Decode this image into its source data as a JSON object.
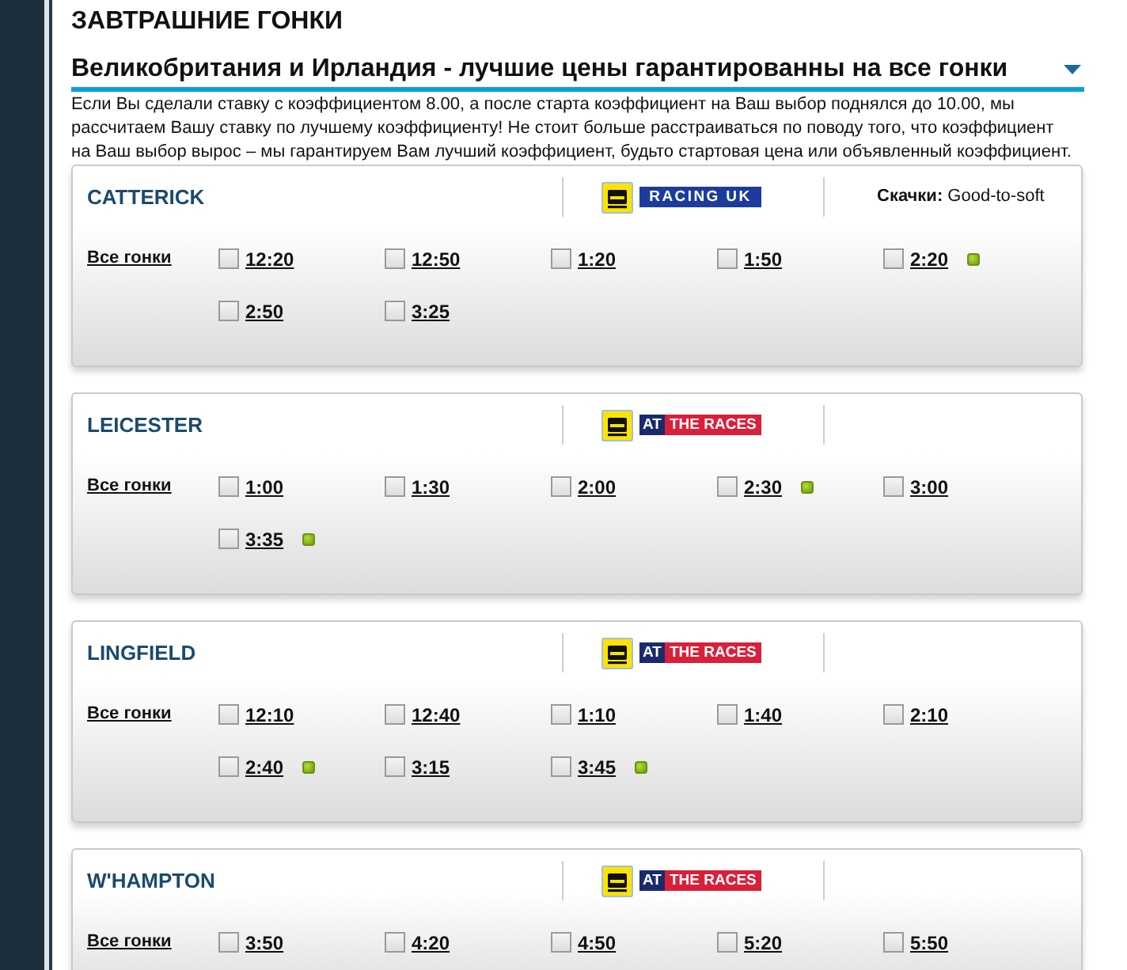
{
  "page": {
    "title": "ЗАВТРАШНИЕ ГОНКИ"
  },
  "region": {
    "title": "Великобритания и Ирландия - лучшие цены гарантированны на все гонки"
  },
  "intro": "Если Вы сделали ставку с коэффициентом 8.00, а после старта коэффициент на Ваш выбор поднялся до 10.00, мы рассчитаем Вашу ставку по лучшему коэффициенту! Не стоит больше расстраиваться по поводу того, что коэффициент на Ваш выбор вырос – мы гарантируем Вам лучший коэффициент, будьто стартовая цена или объявленный коэффициент.",
  "meetings": [
    {
      "name": "CATTERICK",
      "broadcaster": {
        "kind": "racing_uk",
        "words": [
          "RACING UK"
        ]
      },
      "going": "**Скачки:** Good-to-soft",
      "all_races_link": "Все гонки",
      "races": [
        {
          "time": "12:20",
          "checked": false,
          "status_dot": false
        },
        {
          "time": "12:50",
          "checked": false,
          "status_dot": false
        },
        {
          "time": "1:20",
          "checked": false,
          "status_dot": false
        },
        {
          "time": "1:50",
          "checked": false,
          "status_dot": false
        },
        {
          "time": "2:20",
          "checked": false,
          "status_dot": true
        },
        {
          "time": "2:50",
          "checked": false,
          "status_dot": false
        },
        {
          "time": "3:25",
          "checked": false,
          "status_dot": false
        }
      ]
    },
    {
      "name": "LEICESTER",
      "broadcaster": {
        "kind": "at_the_races",
        "words": [
          "AT",
          "THE RACES"
        ]
      },
      "all_races_link": "Все гонки",
      "races": [
        {
          "time": "1:00",
          "checked": false,
          "status_dot": false
        },
        {
          "time": "1:30",
          "checked": false,
          "status_dot": false
        },
        {
          "time": "2:00",
          "checked": false,
          "status_dot": false
        },
        {
          "time": "2:30",
          "checked": false,
          "status_dot": true
        },
        {
          "time": "3:00",
          "checked": false,
          "status_dot": false
        },
        {
          "time": "3:35",
          "checked": false,
          "status_dot": true
        }
      ]
    },
    {
      "name": "LINGFIELD",
      "broadcaster": {
        "kind": "at_the_races",
        "words": [
          "AT",
          "THE RACES"
        ]
      },
      "all_races_link": "Все гонки",
      "races": [
        {
          "time": "12:10",
          "checked": false,
          "status_dot": false
        },
        {
          "time": "12:40",
          "checked": false,
          "status_dot": false
        },
        {
          "time": "1:10",
          "checked": false,
          "status_dot": false
        },
        {
          "time": "1:40",
          "checked": false,
          "status_dot": false
        },
        {
          "time": "2:10",
          "checked": false,
          "status_dot": false
        },
        {
          "time": "2:40",
          "checked": false,
          "status_dot": true
        },
        {
          "time": "3:15",
          "checked": false,
          "status_dot": false
        },
        {
          "time": "3:45",
          "checked": false,
          "status_dot": true
        }
      ]
    },
    {
      "name": "W'HAMPTON",
      "broadcaster": {
        "kind": "at_the_races",
        "words": [
          "AT",
          "THE RACES"
        ]
      },
      "all_races_link": "Все гонки",
      "races": [
        {
          "time": "3:50",
          "checked": false,
          "status_dot": false
        },
        {
          "time": "4:20",
          "checked": false,
          "status_dot": false
        },
        {
          "time": "4:50",
          "checked": false,
          "status_dot": false
        },
        {
          "time": "5:20",
          "checked": false,
          "status_dot": false
        },
        {
          "time": "5:50",
          "checked": false,
          "status_dot": false
        }
      ]
    }
  ]
}
